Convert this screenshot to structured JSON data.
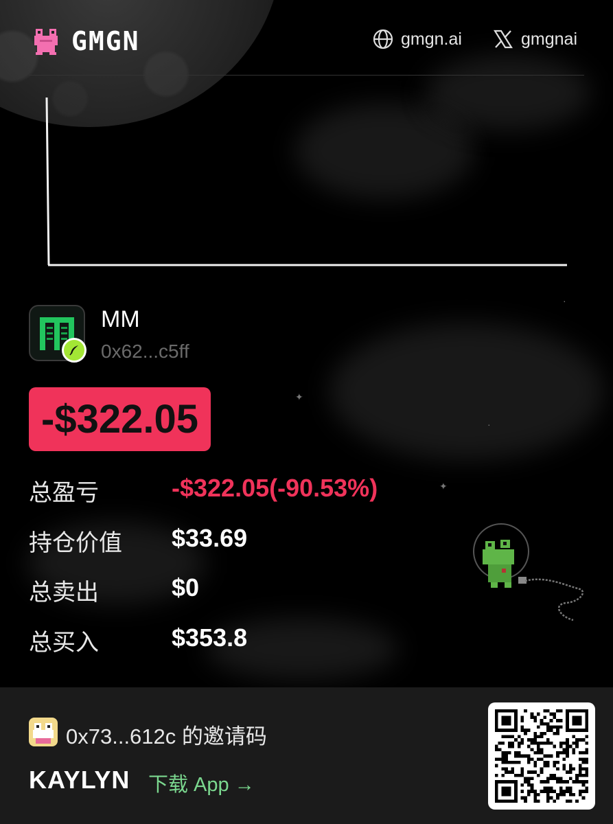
{
  "header": {
    "brand": "GMGN",
    "site_link": "gmgn.ai",
    "x_link": "gmgnai"
  },
  "token": {
    "name": "MM",
    "address": "0x62...c5ff"
  },
  "pnl": {
    "headline": "-$322.05"
  },
  "stats": [
    {
      "label": "总盈亏",
      "value": "-$322.05(-90.53%)"
    },
    {
      "label": "持仓价值",
      "value": "$33.69"
    },
    {
      "label": "总卖出",
      "value": "$0"
    },
    {
      "label": "总买入",
      "value": "$353.8"
    }
  ],
  "footer": {
    "inviter": "0x73...612c 的邀请码",
    "invite_code": "KAYLYN",
    "download": "下载 App →"
  },
  "colors": {
    "negative": "#f0335a",
    "download_green": "#7bd88f",
    "badge_green": "#a3e635"
  }
}
